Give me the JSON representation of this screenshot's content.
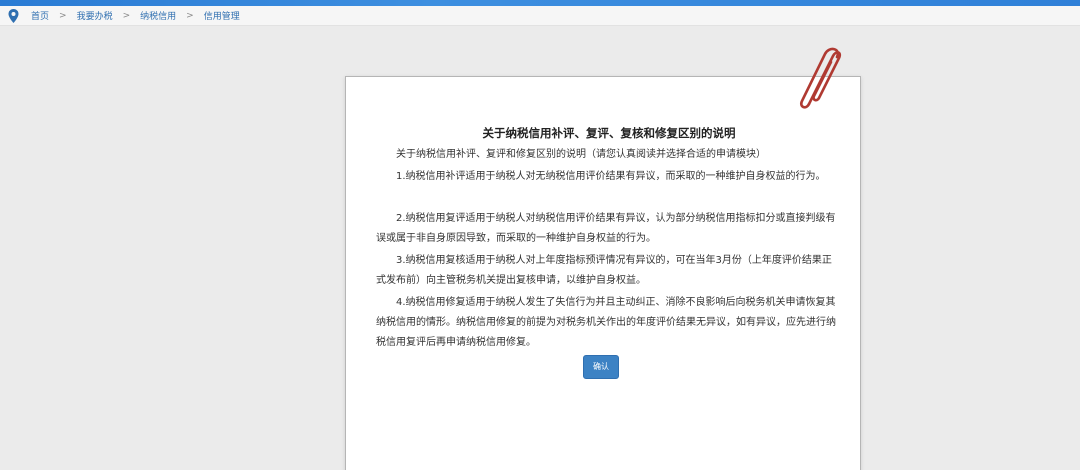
{
  "breadcrumb": {
    "items": [
      "首页",
      "我要办税",
      "纳税信用",
      "信用管理"
    ],
    "separator": ">"
  },
  "dialog": {
    "title": "关于纳税信用补评、复评、复核和修复区别的说明",
    "intro": "关于纳税信用补评、复评和修复区别的说明（请您认真阅读并选择合适的申请模块）",
    "paragraphs": [
      "1.纳税信用补评适用于纳税人对无纳税信用评价结果有异议，而采取的一种维护自身权益的行为。",
      "2.纳税信用复评适用于纳税人对纳税信用评价结果有异议，认为部分纳税信用指标扣分或直接判级有误或属于非自身原因导致，而采取的一种维护自身权益的行为。",
      "3.纳税信用复核适用于纳税人对上年度指标预评情况有异议的，可在当年3月份（上年度评价结果正式发布前）向主管税务机关提出复核申请，以维护自身权益。",
      "4.纳税信用修复适用于纳税人发生了失信行为并且主动纠正、消除不良影响后向税务机关申请恢复其纳税信用的情形。纳税信用修复的前提为对税务机关作出的年度评价结果无异议，如有异议，应先进行纳税信用复评后再申请纳税信用修复。"
    ],
    "confirm_label": "确认"
  },
  "colors": {
    "topbar": "#2a7bd4",
    "link": "#2f6fb0",
    "confirm_button": "#3c82c4",
    "background": "#ebebeb",
    "paperclip": "#c0392b"
  },
  "icons": {
    "location": "location-pin-icon",
    "clip": "paperclip-icon"
  }
}
